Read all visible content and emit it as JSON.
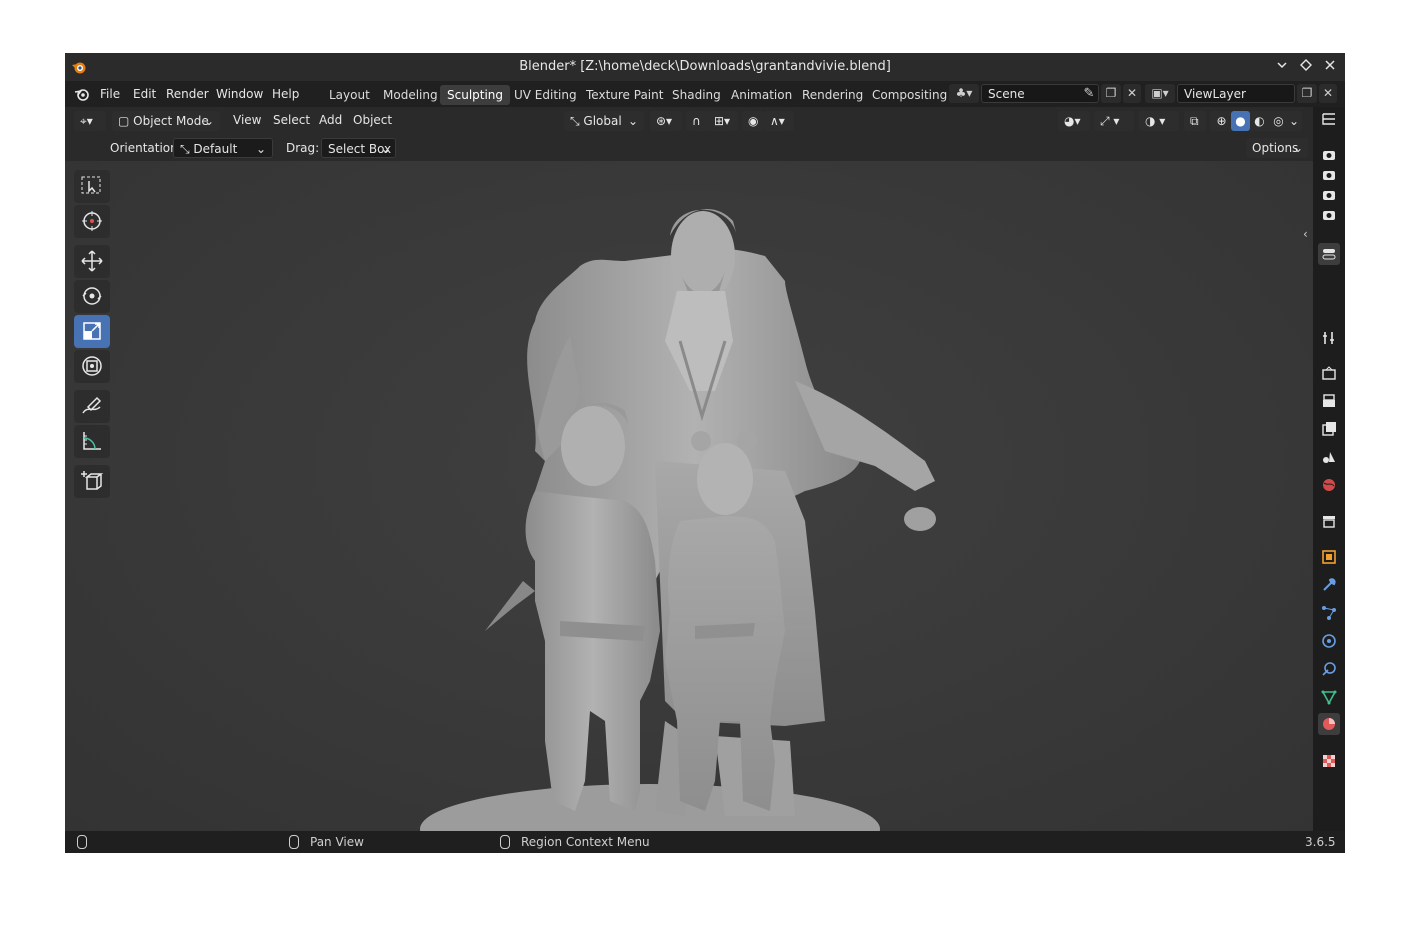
{
  "window": {
    "title": "Blender* [Z:\\home\\deck\\Downloads\\grantandvivie.blend]",
    "controls": [
      "chevron-down",
      "diamond",
      "close"
    ]
  },
  "menubar": {
    "menus": [
      "File",
      "Edit",
      "Render",
      "Window",
      "Help"
    ],
    "workspaces": [
      "Layout",
      "Modeling",
      "Sculpting",
      "UV Editing",
      "Texture Paint",
      "Shading",
      "Animation",
      "Rendering",
      "Compositing"
    ],
    "active_workspace": "Sculpting",
    "scene_name": "Scene",
    "view_layer_name": "ViewLayer"
  },
  "header": {
    "mode": "Object Mode",
    "menus": [
      "View",
      "Select",
      "Add",
      "Object"
    ],
    "transform_orientation": "Global"
  },
  "tool_settings": {
    "orientation_label": "Orientation:",
    "orientation_value": "Default",
    "drag_label": "Drag:",
    "drag_value": "Select Box",
    "options_label": "Options"
  },
  "toolbar": {
    "tools": [
      "select-box",
      "cursor",
      "move",
      "rotate",
      "scale",
      "transform",
      "annotate",
      "measure",
      "add-cube"
    ],
    "active_tool": "scale"
  },
  "properties_tabs": [
    "tool",
    "render",
    "output",
    "view-layer",
    "scene",
    "world",
    "collection",
    "object",
    "modifiers",
    "particles",
    "physics",
    "constraints",
    "data",
    "material",
    "texture"
  ],
  "statusbar": {
    "pan_view": "Pan View",
    "context_menu": "Region Context Menu",
    "version": "3.6.5"
  },
  "colors": {
    "accent": "#4772b3",
    "viewport_bg": "#3a3a3a",
    "model": "#a8a8a8"
  }
}
